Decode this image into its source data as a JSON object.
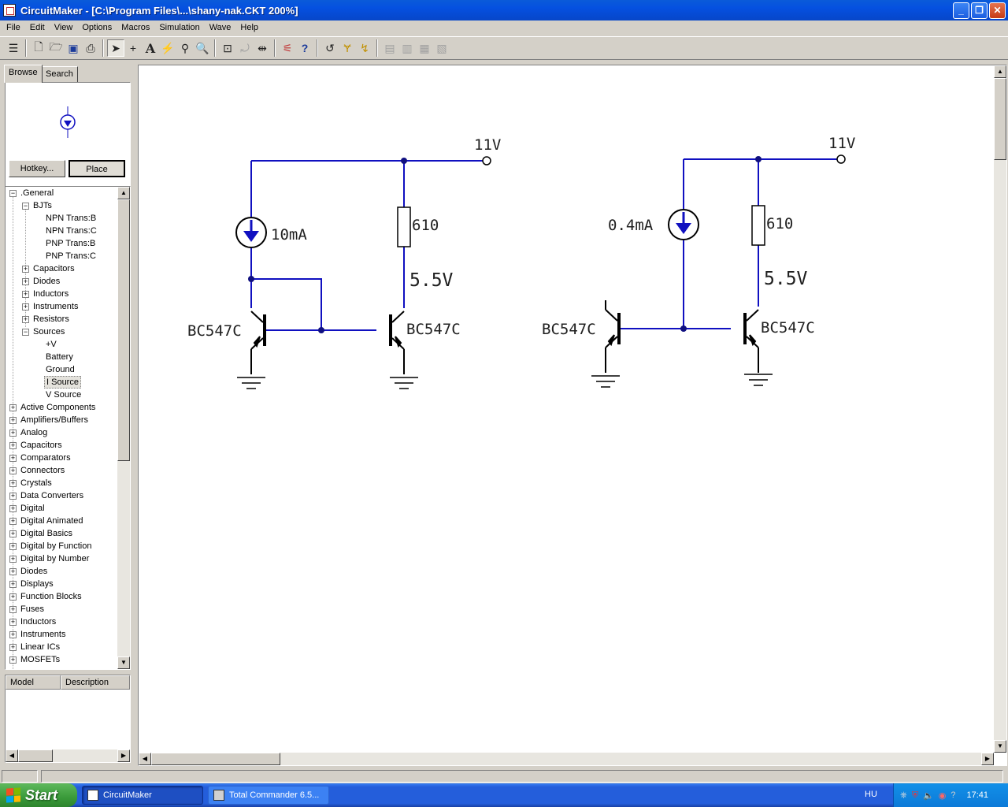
{
  "window": {
    "title": "CircuitMaker - [C:\\Program Files\\...\\shany-nak.CKT 200%]"
  },
  "menu": [
    "File",
    "Edit",
    "View",
    "Options",
    "Macros",
    "Simulation",
    "Wave",
    "Help"
  ],
  "toolbar": {
    "icons": [
      "pointer-icon",
      "wire-icon",
      "text-icon",
      "probe-icon",
      "wand-icon",
      "zoom-icon",
      "new-icon",
      "open-icon",
      "save-icon",
      "print-icon"
    ]
  },
  "panel": {
    "tabs": [
      "Browse",
      "Search"
    ],
    "hotkey_label": "Hotkey...",
    "place_label": "Place",
    "model_col": "Model",
    "desc_col": "Description"
  },
  "tree": {
    "general": ".General",
    "bjts": "BJTs",
    "bjt_items": [
      "NPN Trans:B",
      "NPN Trans:C",
      "PNP Trans:B",
      "PNP Trans:C"
    ],
    "sub_groups": [
      "Capacitors",
      "Diodes",
      "Inductors",
      "Instruments",
      "Resistors"
    ],
    "sources": "Sources",
    "source_items": [
      "+V",
      "Battery",
      "Ground",
      "I Source",
      "V Source"
    ],
    "selected": "I Source",
    "categories": [
      "Active Components",
      "Amplifiers/Buffers",
      "Analog",
      "Capacitors",
      "Comparators",
      "Connectors",
      "Crystals",
      "Data Converters",
      "Digital",
      "Digital Animated",
      "Digital Basics",
      "Digital by Function",
      "Digital by Number",
      "Diodes",
      "Displays",
      "Function Blocks",
      "Fuses",
      "Inductors",
      "Instruments",
      "Linear ICs",
      "MOSFETs"
    ]
  },
  "schematic": {
    "left": {
      "supply": "11V",
      "current": "10mA",
      "resistor": "610",
      "node_voltage": "5.5V",
      "q1": "BC547C",
      "q2": "BC547C"
    },
    "right": {
      "supply": "11V",
      "current": "0.4mA",
      "resistor": "610",
      "node_voltage": "5.5V",
      "q1": "BC547C",
      "q2": "BC547C"
    },
    "wire_color": "#1010c0"
  },
  "taskbar": {
    "start": "Start",
    "tasks": [
      "CircuitMaker",
      "Total Commander 6.5..."
    ],
    "lang": "HU",
    "clock": "17:41"
  }
}
